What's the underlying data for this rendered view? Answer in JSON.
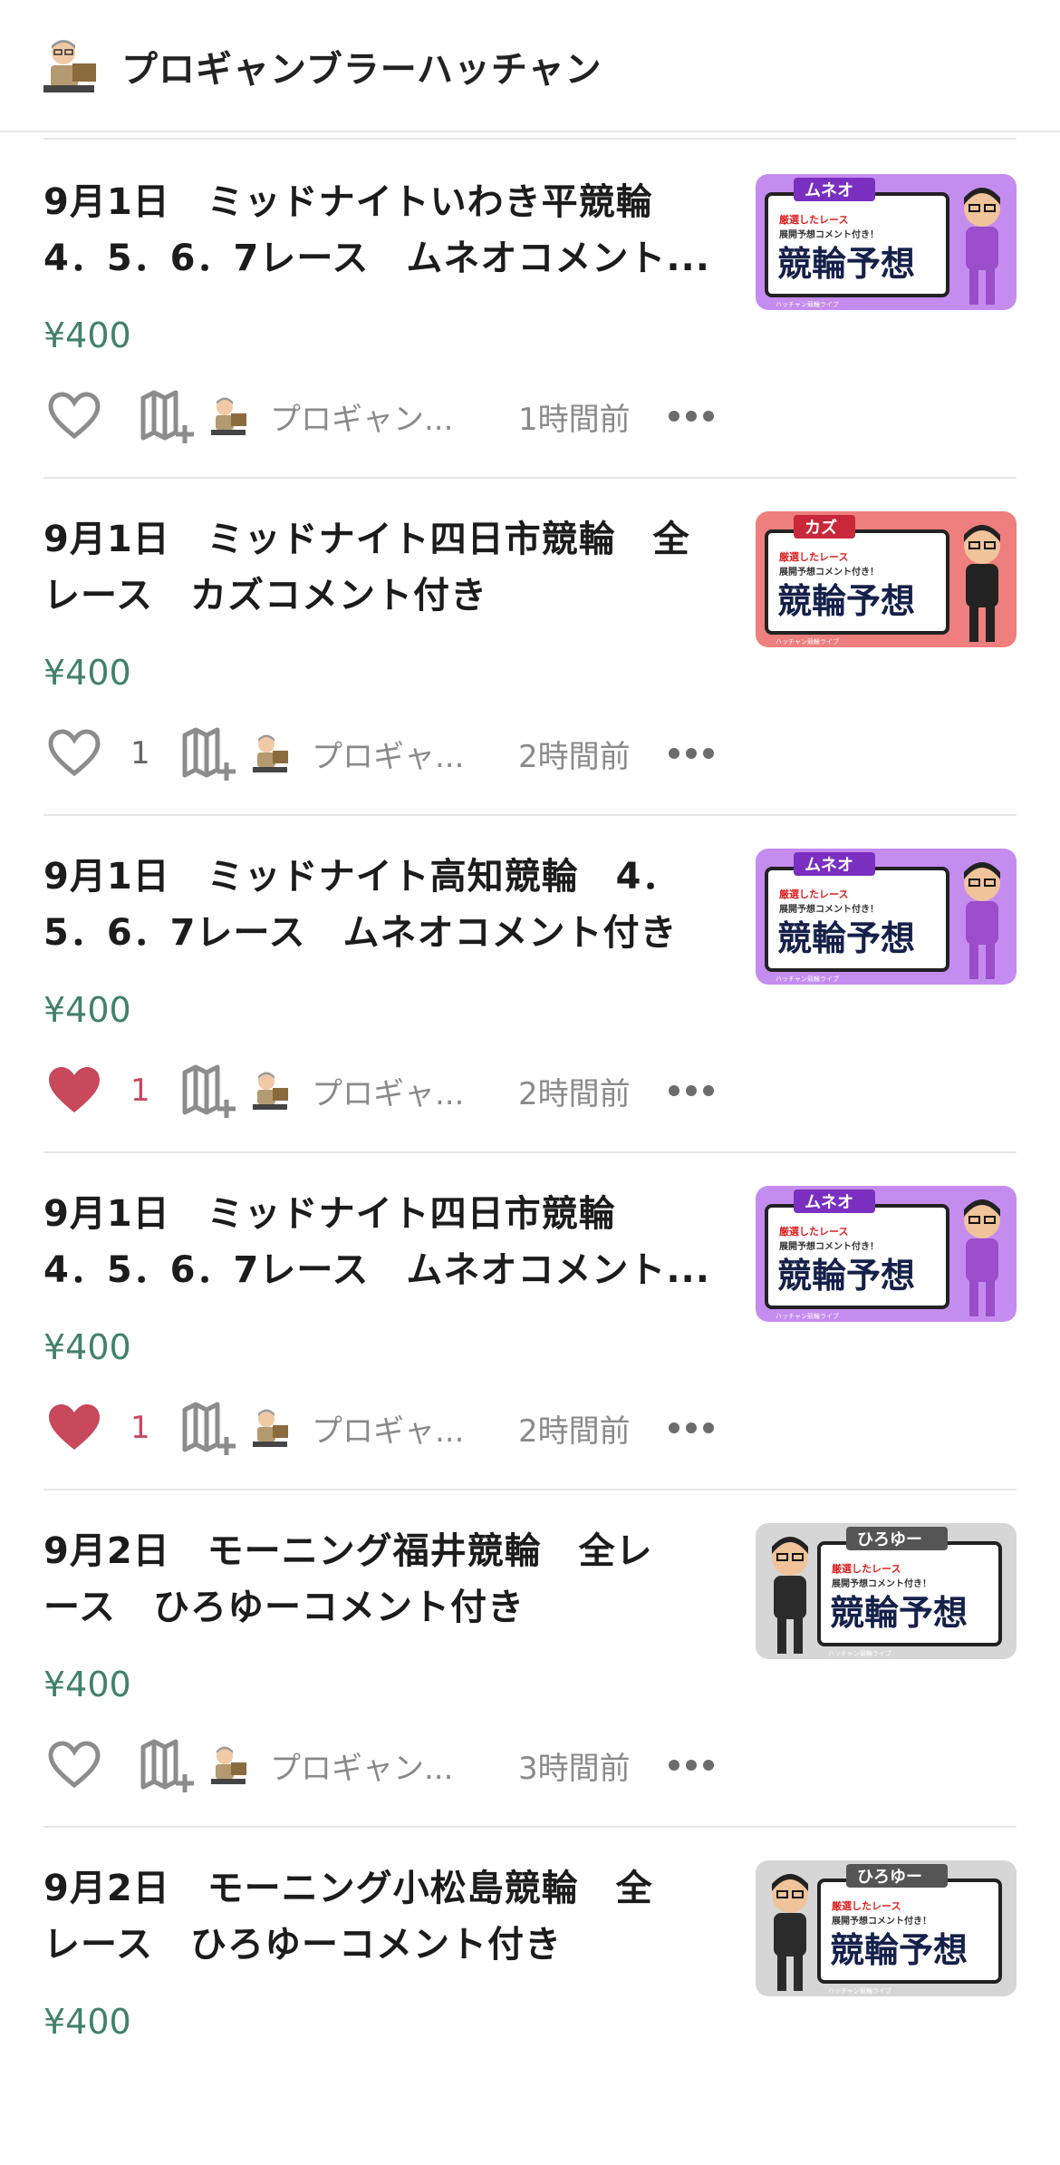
{
  "header": {
    "title": "プロギャンブラーハッチャン",
    "avatar_icon": "avatar-icon"
  },
  "colors": {
    "price": "#41816a",
    "liked_heart": "#c8485c",
    "muted": "#8a8a8a"
  },
  "items": [
    {
      "title_line1": "9月1日　ミッドナイトいわき平競輪",
      "title_line2": "4．5．6．7レース　ムネオコメント...",
      "price": "¥400",
      "liked": false,
      "like_count": "",
      "author": "プロギャン...",
      "time": "1時間前",
      "thumb": {
        "badge": "ムネオ",
        "theme": "purple",
        "line_a": "厳選したレース",
        "line_b": "展開予想コメント付き！",
        "main": "競輪予想",
        "footer": "ハッチャン競輪ライブ"
      }
    },
    {
      "title_line1": "9月1日　ミッドナイト四日市競輪　全",
      "title_line2": "レース　カズコメント付き",
      "price": "¥400",
      "liked": false,
      "like_count": "1",
      "author": "プロギャ...",
      "time": "2時間前",
      "thumb": {
        "badge": "カズ",
        "theme": "red",
        "line_a": "厳選したレース",
        "line_b": "展開予想コメント付き！",
        "main": "競輪予想",
        "footer": "ハッチャン競輪ライブ"
      }
    },
    {
      "title_line1": "9月1日　ミッドナイト高知競輪　4．",
      "title_line2": "5．6．7レース　ムネオコメント付き",
      "price": "¥400",
      "liked": true,
      "like_count": "1",
      "author": "プロギャ...",
      "time": "2時間前",
      "thumb": {
        "badge": "ムネオ",
        "theme": "purple",
        "line_a": "厳選したレース",
        "line_b": "展開予想コメント付き！",
        "main": "競輪予想",
        "footer": "ハッチャン競輪ライブ"
      }
    },
    {
      "title_line1": "9月1日　ミッドナイト四日市競輪",
      "title_line2": "4．5．6．7レース　ムネオコメント...",
      "price": "¥400",
      "liked": true,
      "like_count": "1",
      "author": "プロギャ...",
      "time": "2時間前",
      "thumb": {
        "badge": "ムネオ",
        "theme": "purple",
        "line_a": "厳選したレース",
        "line_b": "展開予想コメント付き！",
        "main": "競輪予想",
        "footer": "ハッチャン競輪ライブ"
      }
    },
    {
      "title_line1": "9月2日　モーニング福井競輪　全レ",
      "title_line2": "ース　ひろゆーコメント付き",
      "price": "¥400",
      "liked": false,
      "like_count": "",
      "author": "プロギャン...",
      "time": "3時間前",
      "thumb": {
        "badge": "ひろゆー",
        "theme": "gray",
        "line_a": "厳選したレース",
        "line_b": "展開予想コメント付き！",
        "main": "競輪予想",
        "footer": "ハッチャン競輪ライブ"
      }
    },
    {
      "title_line1": "9月2日　モーニング小松島競輪　全",
      "title_line2": "レース　ひろゆーコメント付き",
      "price": "¥400",
      "liked": false,
      "like_count": "",
      "author": "",
      "time": "",
      "thumb": {
        "badge": "ひろゆー",
        "theme": "gray",
        "line_a": "厳選したレース",
        "line_b": "展開予想コメント付き！",
        "main": "競輪予想",
        "footer": "ハッチャン競輪ライブ"
      }
    }
  ]
}
